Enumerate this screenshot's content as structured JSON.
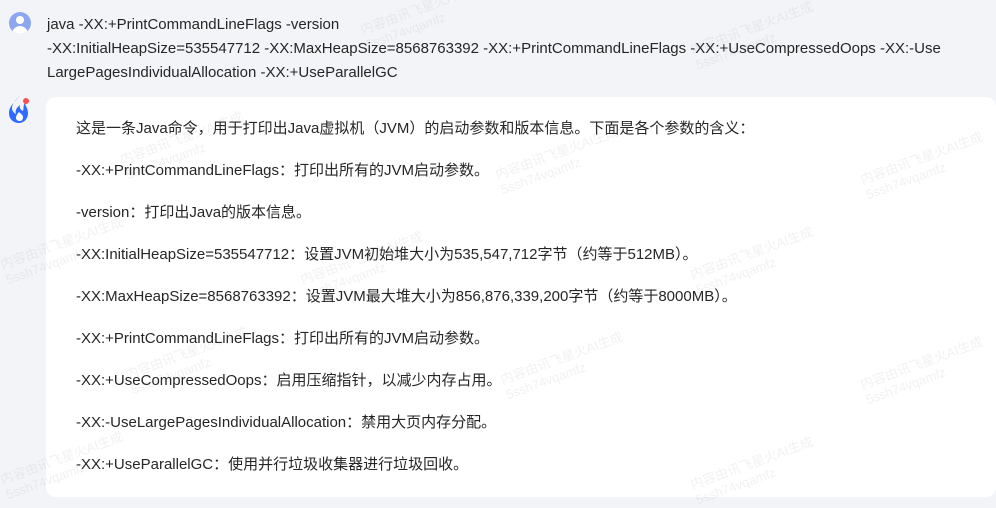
{
  "user_message": {
    "text": "java -XX:+PrintCommandLineFlags -version\n-XX:InitialHeapSize=535547712 -XX:MaxHeapSize=8568763392 -XX:+PrintCommandLineFlags -XX:+UseCompressedOops -XX:-UseLargePagesIndividualAllocation -XX:+UseParallelGC"
  },
  "assistant_message": {
    "lines": [
      "这是一条Java命令，用于打印出Java虚拟机（JVM）的启动参数和版本信息。下面是各个参数的含义：",
      "-XX:+PrintCommandLineFlags：打印出所有的JVM启动参数。",
      "-version：打印出Java的版本信息。",
      "-XX:InitialHeapSize=535547712：设置JVM初始堆大小为535,547,712字节（约等于512MB）。",
      "-XX:MaxHeapSize=8568763392：设置JVM最大堆大小为856,876,339,200字节（约等于8000MB）。",
      "-XX:+PrintCommandLineFlags：打印出所有的JVM启动参数。",
      "-XX:+UseCompressedOops：启用压缩指针，以减少内存占用。",
      "-XX:-UseLargePagesIndividualAllocation：禁用大页内存分配。",
      "-XX:+UseParallelGC：使用并行垃圾收集器进行垃圾回收。"
    ]
  },
  "watermark": {
    "text": "内容由讯飞星火AI生成\n5ssh74vqamfz"
  },
  "colors": {
    "page_background": "#f3f4f8",
    "card_background": "#ffffff",
    "text": "#262626",
    "user_avatar": "#8da6f0",
    "bot_logo_primary": "#2f6bff",
    "bot_logo_accent": "#ff4d4f"
  },
  "icons": {
    "user_avatar": "user-avatar-icon",
    "assistant_avatar": "spark-logo-icon"
  }
}
